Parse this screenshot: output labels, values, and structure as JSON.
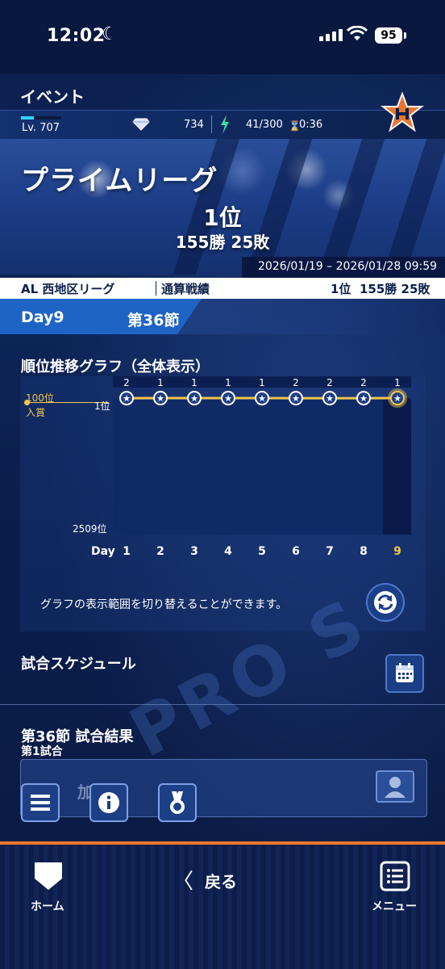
{
  "status_bar": {
    "time": "12:02",
    "battery": "95"
  },
  "header": {
    "title": "イベント"
  },
  "resources": {
    "level": "Lv. 707",
    "gems": "734",
    "stamina": "41/300",
    "timer": "0:36"
  },
  "league": {
    "name": "プライムリーグ",
    "rank": "1位",
    "record": "155勝 25敗",
    "period": "2026/01/19 – 2026/01/28 09:59"
  },
  "record_row": {
    "league": "AL 西地区リーグ",
    "label": "通算戦績",
    "rank": "1位",
    "wins_losses": "155勝 25敗"
  },
  "day_row": {
    "day": "Day9",
    "section": "第36節"
  },
  "chart": {
    "title": "順位推移グラフ（全体表示）",
    "badge_line1": "100位",
    "badge_line2": "入賞",
    "y_top": "1位",
    "y_bottom": "2509位",
    "day_axis_label": "Day",
    "days": [
      "1",
      "2",
      "3",
      "4",
      "5",
      "6",
      "7",
      "8",
      "9"
    ],
    "daily_ranks": [
      "2",
      "1",
      "1",
      "1",
      "1",
      "2",
      "2",
      "2",
      "1"
    ],
    "note": "グラフの表示範囲を切り替えることができます。",
    "colors": {
      "line": "#f2c64d",
      "current_day": "#f2c64d"
    }
  },
  "chart_data": {
    "type": "line",
    "x": [
      1,
      2,
      3,
      4,
      5,
      6,
      7,
      8,
      9
    ],
    "y": [
      2,
      1,
      1,
      1,
      1,
      2,
      2,
      2,
      1
    ],
    "xlabel": "Day",
    "ylim": [
      1,
      2509
    ]
  },
  "schedule": {
    "title": "試合スケジュール"
  },
  "results": {
    "title": "第36節  試合結果",
    "game_label": "第1試合",
    "team_initial": "加"
  },
  "bottom_nav": {
    "home": "ホーム",
    "back_arrow": "〈",
    "back": "戻る",
    "menu": "メニュー"
  },
  "watermark": "PRO S"
}
